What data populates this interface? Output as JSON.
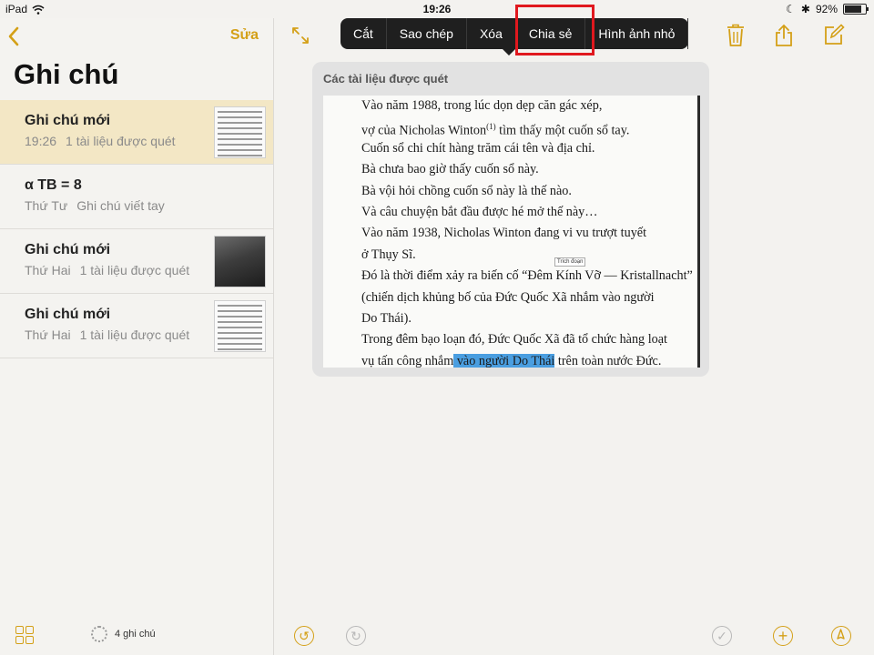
{
  "status_bar": {
    "device": "iPad",
    "time": "19:26",
    "battery": "92%",
    "battery_level": 0.92
  },
  "sidebar": {
    "edit_label": "Sửa",
    "title": "Ghi chú",
    "notes": [
      {
        "title": "Ghi chú mới",
        "date": "19:26",
        "subtitle": "1 tài liệu được quét",
        "selected": true,
        "thumb": "scanned-doc"
      },
      {
        "title": "α TB = 8",
        "date": "Thứ Tư",
        "subtitle": "Ghi chú viết tay",
        "selected": false,
        "thumb": null
      },
      {
        "title": "Ghi chú mới",
        "date": "Thứ Hai",
        "subtitle": "1 tài liệu được quét",
        "selected": false,
        "thumb": "photo"
      },
      {
        "title": "Ghi chú mới",
        "date": "Thứ Hai",
        "subtitle": "1 tài liệu được quét",
        "selected": false,
        "thumb": "scanned-doc"
      }
    ],
    "note_count": "4 ghi chú"
  },
  "context_menu": {
    "items": [
      "Cắt",
      "Sao chép",
      "Xóa",
      "Chia sẻ",
      "Hình ảnh nhỏ"
    ],
    "highlighted": "Chia sẻ"
  },
  "document": {
    "card_title": "Các tài liệu được quét",
    "lines": [
      "Vào năm 1988, trong lúc dọn dẹp căn gác xép,",
      "vợ của Nicholas Winton",
      "Cuốn sổ chi chít hàng trăm cái tên và địa chỉ.",
      "Bà chưa bao giờ thấy cuốn sổ này.",
      "Bà vội hỏi chồng cuốn sổ này là thế nào.",
      "Và câu chuyện bắt đầu được hé mở thế này…",
      "Vào năm 1938, Nicholas Winton đang vi vu trượt tuyết",
      "ở Thụy Sĩ.",
      "Đó là thời điểm xảy ra biến cố “Đêm Kính Vỡ — Kristallnacht”",
      "(chiến dịch khủng bố của Đức Quốc Xã nhắm vào người",
      "Do Thái).",
      "Trong đêm bạo loạn đó, Đức Quốc Xã đã tổ chức hàng loạt",
      "vụ tấn công nhắm"
    ],
    "line2_sup": "(1)",
    "line2_rest": " tìm thấy một cuốn sổ tay.",
    "last_line_highlight": " vào người Do Thái",
    "last_line_rest": " trên toàn nước Đức.",
    "tooltip": "Trích đoạn"
  },
  "colors": {
    "accent": "#d4a017",
    "highlight_box": "#e0181e",
    "selected_row": "#f3e7c5"
  },
  "icons": {
    "back": "chevron-left-icon",
    "expand": "expand-icon",
    "trash": "trash-icon",
    "share": "share-icon",
    "compose": "compose-icon",
    "grid": "grid-icon",
    "undo": "undo-icon",
    "redo": "redo-icon",
    "checklist": "checklist-icon",
    "add": "add-icon",
    "markup": "markup-pen-icon"
  }
}
